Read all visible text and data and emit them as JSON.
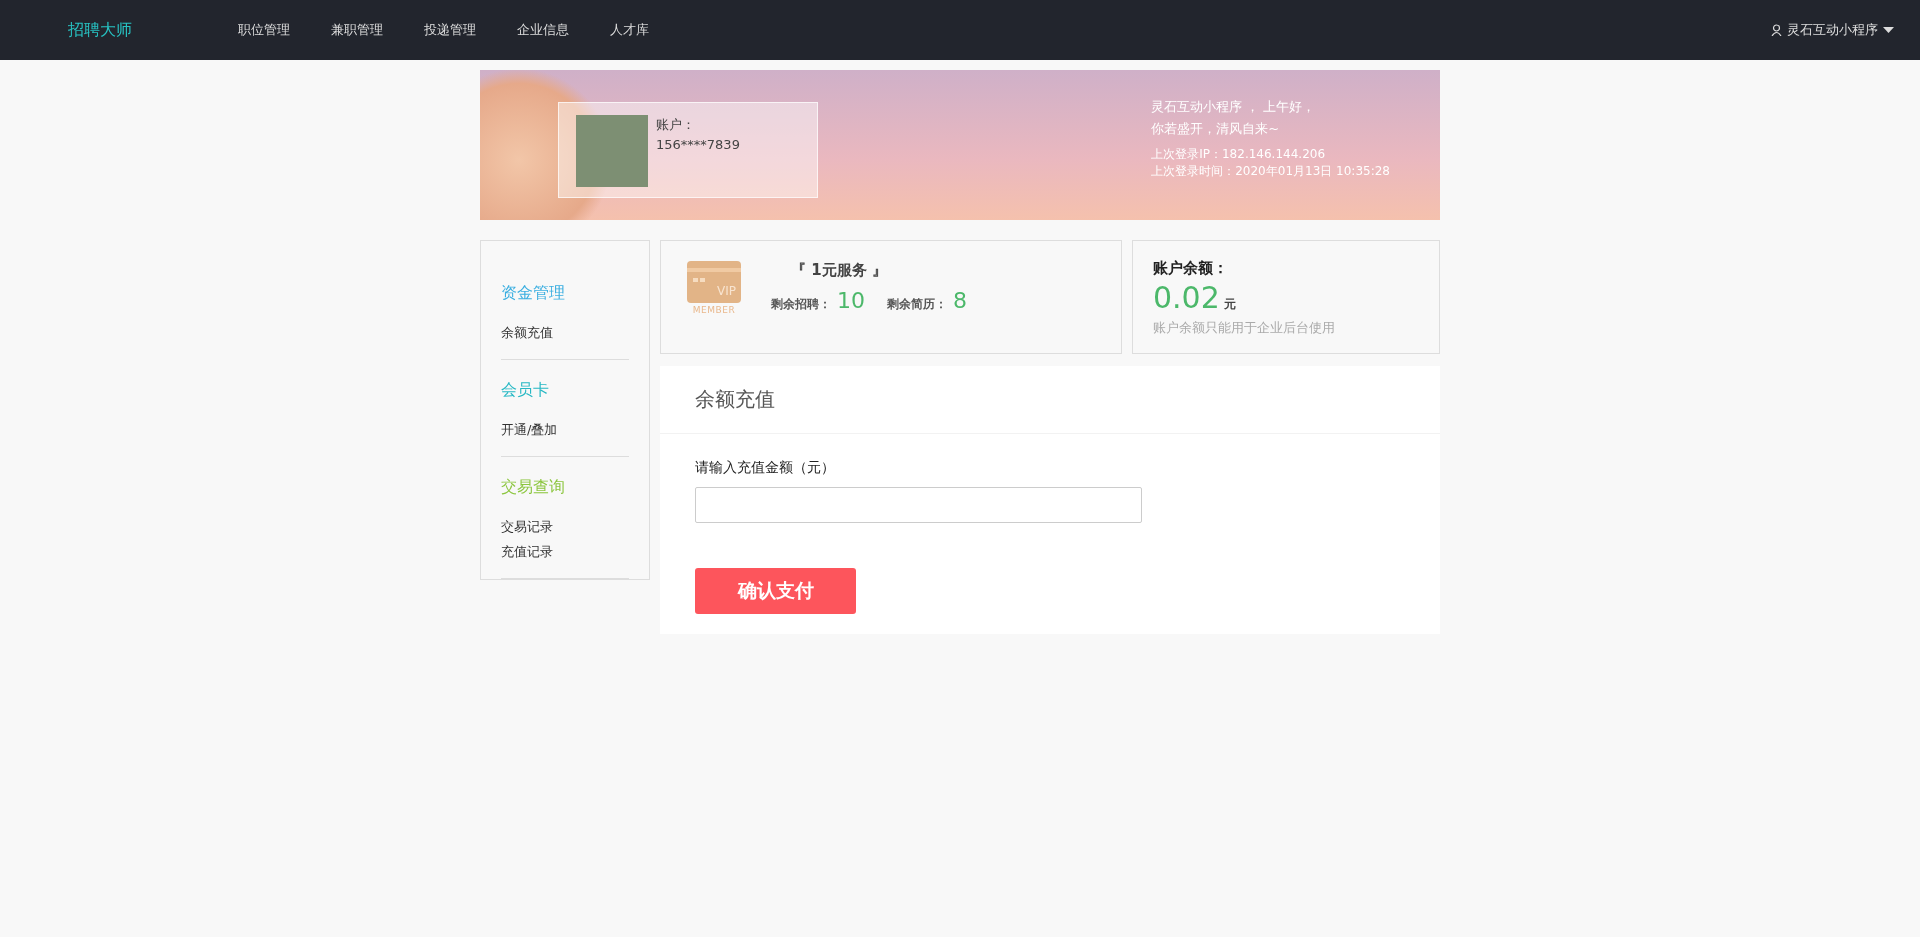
{
  "topbar": {
    "logo": "招聘大师",
    "nav": [
      {
        "label": "职位管理"
      },
      {
        "label": "兼职管理"
      },
      {
        "label": "投递管理"
      },
      {
        "label": "企业信息"
      },
      {
        "label": "人才库"
      }
    ],
    "user": "灵石互动小程序"
  },
  "banner": {
    "account_label": "账户：",
    "account": "156****7839",
    "greeting": "灵石互动小程序 ，  上午好，",
    "motto": "你若盛开，清风自来~",
    "last_ip": "上次登录IP：182.146.144.206",
    "last_time": "上次登录时间：2020年01月13日 10:35:28"
  },
  "sidebar": {
    "groups": [
      {
        "title": "资金管理",
        "color": "#3aaee0",
        "items": [
          {
            "label": "余额充值"
          }
        ]
      },
      {
        "title": "会员卡",
        "color": "#27b8c4",
        "items": [
          {
            "label": "开通/叠加"
          }
        ]
      },
      {
        "title": "交易查询",
        "color": "#8cc63f",
        "items": [
          {
            "label": "交易记录"
          },
          {
            "label": "充值记录"
          }
        ]
      }
    ]
  },
  "service": {
    "card_text": "VIP",
    "card_caption": "MEMBER",
    "title": "『 1元服务 』",
    "remaining_jobs_label": "剩余招聘：",
    "remaining_jobs": "10",
    "remaining_resumes_label": "剩余简历：",
    "remaining_resumes": "8"
  },
  "balance": {
    "label": "账户余额：",
    "amount": "0.02",
    "unit": "元",
    "note": "账户余额只能用于企业后台使用"
  },
  "recharge": {
    "title": "余额充值",
    "field_label": "请输入充值金额（元）",
    "submit": "确认支付"
  }
}
